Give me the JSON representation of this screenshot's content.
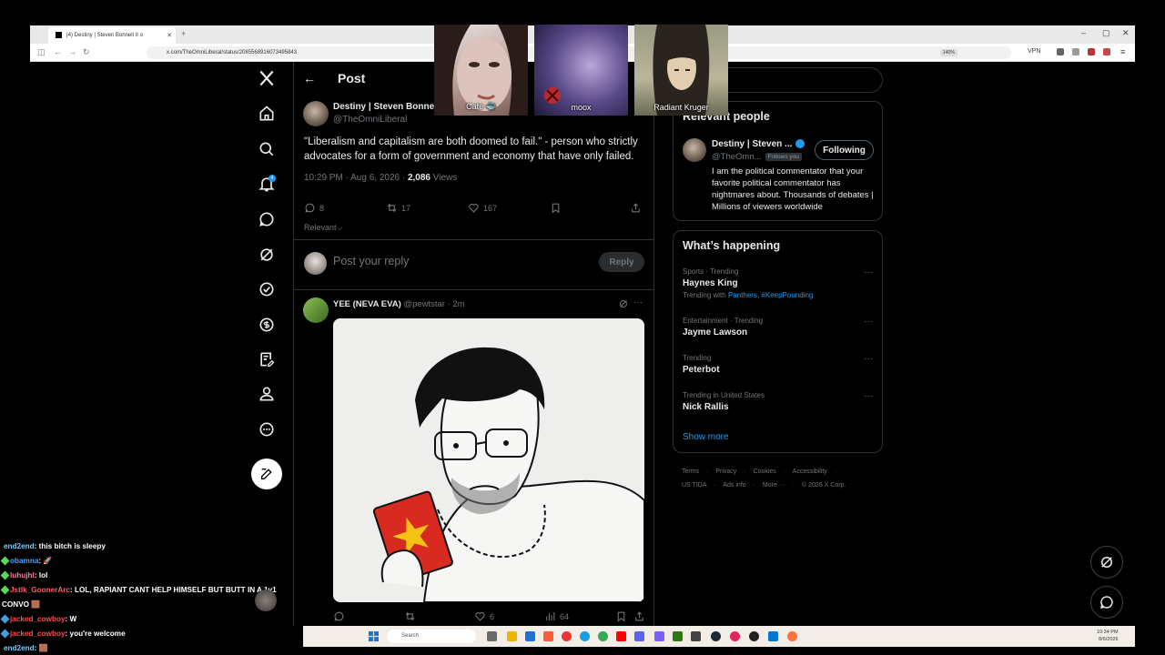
{
  "browser": {
    "tab_title": "(4) Destiny | Steven Bonnell II o",
    "tab_close": "✕",
    "new_tab": "+",
    "url": "x.com/TheOmniLiberal/status/2085568916073495843",
    "zoom": "140%",
    "vpn_label": "VPN"
  },
  "nav": {
    "items": [
      "home",
      "explore",
      "notifications",
      "messages",
      "grok",
      "verified",
      "premium",
      "lists",
      "profile",
      "more"
    ],
    "notification_count": "4"
  },
  "post": {
    "header_title": "Post",
    "author_name": "Destiny | Steven Bonnell II",
    "author_handle": "@TheOmniLiberal",
    "text": "\"Liberalism and capitalism are both doomed to fail.\" - person who strictly advocates for a form of government and economy that have only failed.",
    "time": "10:29 PM · Aug 6, 2026 · ",
    "views_count": "2,086",
    "views_label": " Views",
    "replies": "8",
    "reposts": "17",
    "likes": "167",
    "filter": "Relevant"
  },
  "reply_box": {
    "placeholder": "Post your reply",
    "button": "Reply"
  },
  "reply": {
    "author_name": "YEE (NEVA EVA)",
    "author_meta": " @pewtstar · 2m",
    "more": "···",
    "reposts": "",
    "likes": "6",
    "views": "64"
  },
  "relevant_people": {
    "title": "Relevant people",
    "name": "Destiny | Steven ...",
    "handle": "@TheOmn...",
    "follows_you": "Follows you",
    "button": "Following",
    "bio": "I am the political commentator that your favorite political commentator has nightmares about. Thousands of debates | Millions of viewers worldwide"
  },
  "happening": {
    "title": "What’s happening",
    "trends": [
      {
        "meta": "Sports · Trending",
        "name": "Haynes King",
        "extra_prefix": "Trending with ",
        "extra_links": "Panthers, #KeepPounding"
      },
      {
        "meta": "Entertainment · Trending",
        "name": "Jayme Lawson",
        "extra_prefix": "",
        "extra_links": ""
      },
      {
        "meta": "Trending",
        "name": "Peterbot",
        "extra_prefix": "",
        "extra_links": ""
      },
      {
        "meta": "Trending in United States",
        "name": "Nick Rallis",
        "extra_prefix": "",
        "extra_links": ""
      }
    ],
    "more": "···",
    "show_more": "Show more"
  },
  "footer": {
    "line1": [
      "Terms",
      "·",
      "Privacy",
      "·",
      "Cookies",
      "·",
      "Accessibility",
      "·"
    ],
    "line2": [
      "US TIDA",
      "·",
      "Ads info",
      "·",
      "More ···",
      "·",
      "© 2026 X Corp."
    ]
  },
  "webcams": [
    {
      "label": "Cate 🐳"
    },
    {
      "label": "moox"
    },
    {
      "label": "Radiant Kruger"
    }
  ],
  "chat": [
    {
      "user": "end2end",
      "text": ": this bitch is sleepy"
    },
    {
      "user": "obamna",
      "text": ": 🚀"
    },
    {
      "user": "luhujhl",
      "text": ": lol"
    },
    {
      "user": "Jstlk_GoonerArc",
      "text": ": LOL, RAPIANT CANT HELP HIMSELF BUT BUTT IN A 1v1"
    },
    {
      "user": "",
      "text": "CONVO 🟫"
    },
    {
      "user": "jacked_cowboy",
      "text": ": W"
    },
    {
      "user": "jacked_cowboy",
      "text": ": you're welcome"
    },
    {
      "user": "end2end",
      "text": ": 🟫"
    }
  ],
  "taskbar": {
    "search": "Search",
    "time": "10:34 PM",
    "date": "8/6/2026"
  },
  "colors": {
    "accent": "#1d9bf0",
    "background": "#000000",
    "border": "#2f3336",
    "muted_text": "#71767b"
  }
}
